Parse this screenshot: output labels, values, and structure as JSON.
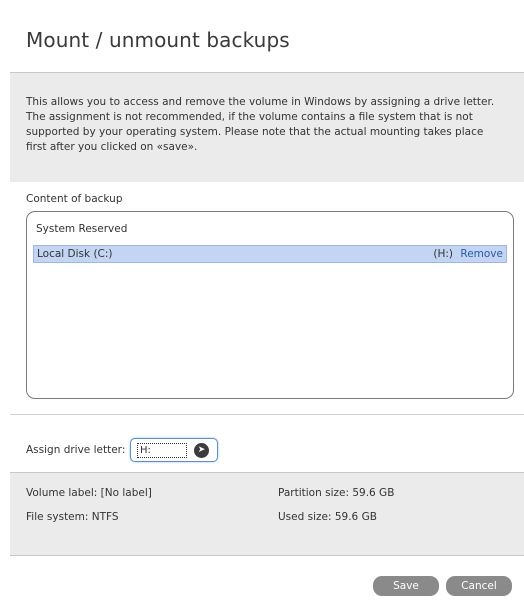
{
  "dialog": {
    "title": "Mount / unmount backups",
    "description": "This allows you to access and remove the volume in Windows by assigning a drive letter. The assignment is not recommended, if the volume contains a file system that is not supported by your operating system. Please note that the actual mounting takes place first after you clicked on «save»."
  },
  "content": {
    "label": "Content of backup",
    "items": [
      {
        "name": "System Reserved",
        "drive": "",
        "action": ""
      },
      {
        "name": "Local Disk (C:)",
        "drive": "(H:)",
        "action": "Remove",
        "selected": true
      }
    ]
  },
  "assign": {
    "label": "Assign drive letter:",
    "value": "H:",
    "go_icon": "arrow-right-circle-icon"
  },
  "properties": {
    "volume_label": "Volume label:",
    "volume_label_value": "[No label]",
    "file_system": "File system:",
    "file_system_value": "NTFS",
    "partition_size": "Partition size:",
    "partition_size_value": "59.6 GB",
    "used_size": "Used size:",
    "used_size_value": "59.6 GB"
  },
  "buttons": {
    "save": "Save",
    "cancel": "Cancel"
  },
  "colors": {
    "selection": "#c3d5f2",
    "link": "#2b5aa8",
    "button": "#8a8a8a"
  }
}
